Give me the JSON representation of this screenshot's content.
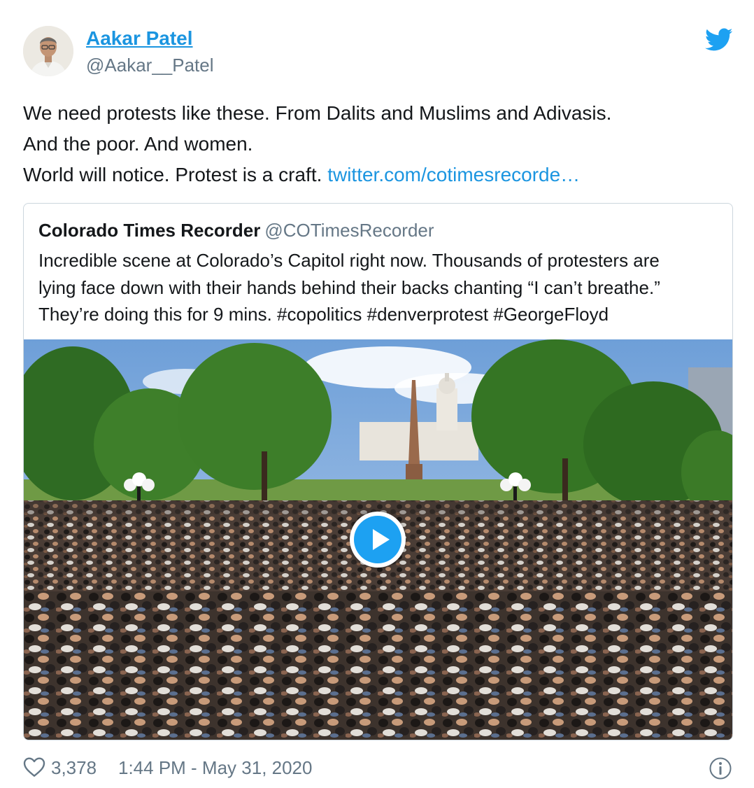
{
  "author": {
    "name": "Aakar Patel",
    "handle": "@Aakar__Patel",
    "avatar_icon": "profile-photo"
  },
  "brand": {
    "logo_icon": "twitter-bird-icon",
    "color": "#1da1f2"
  },
  "tweet": {
    "lines": [
      "We need protests like these. From Dalits and Muslims and Adivasis.",
      "And the poor. And women."
    ],
    "last_line_text": "World will notice. Protest is a craft.",
    "link_text": "twitter.com/cotimesrecorde…"
  },
  "quoted_tweet": {
    "name": "Colorado Times Recorder",
    "handle": "@COTimesRecorder",
    "lines": [
      "Incredible scene at Colorado’s Capitol right now. Thousands of protesters are",
      "lying face down with their hands behind their backs chanting “I can’t breathe.”",
      "They’re doing this for 9 mins. #copolitics #denverprotest #GeorgeFloyd"
    ],
    "media": {
      "type": "video",
      "play_icon": "play-icon"
    }
  },
  "footer": {
    "like_icon": "heart-icon",
    "like_count": "3,378",
    "timestamp": "1:44 PM - May 31, 2020",
    "info_icon": "info-icon"
  },
  "colors": {
    "link": "#1b95e0",
    "text": "#14171a",
    "secondary": "#657786",
    "border": "#ccd6dd"
  }
}
